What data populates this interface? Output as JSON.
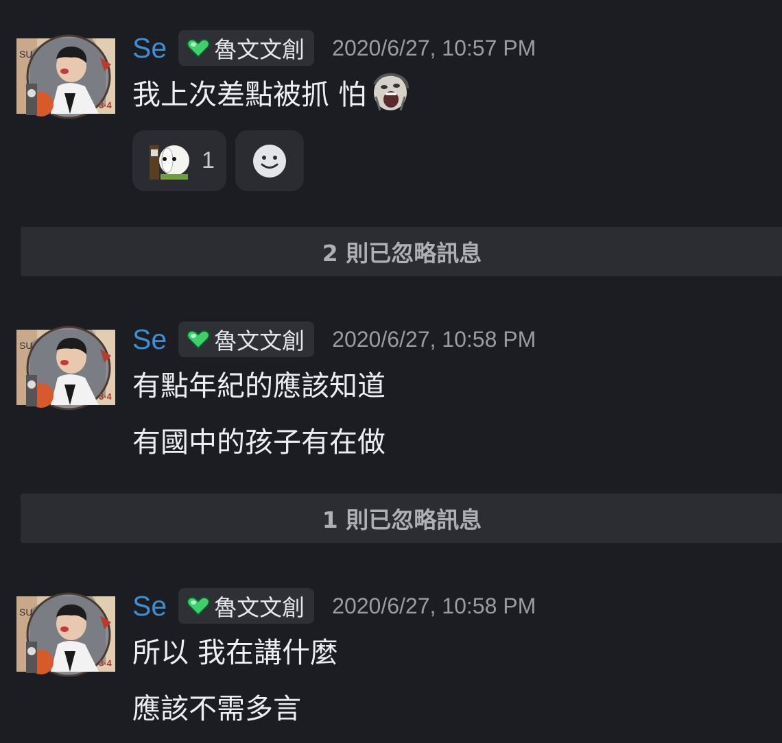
{
  "messages": [
    {
      "username": "Se",
      "role": "魯文文創",
      "timestamp": "2020/6/27, 10:57 PM",
      "lines": [
        "我上次差點被抓 怕"
      ],
      "reactions": [
        {
          "emoji": "panda-face-emoji",
          "count": "1"
        }
      ],
      "add_reaction_icon": "smiley-add-reaction-icon"
    },
    {
      "username": "Se",
      "role": "魯文文創",
      "timestamp": "2020/6/27, 10:58 PM",
      "lines": [
        "有點年紀的應該知道",
        "有國中的孩子有在做"
      ]
    },
    {
      "username": "Se",
      "role": "魯文文創",
      "timestamp": "2020/6/27, 10:58 PM",
      "lines": [
        "所以 我在講什麼",
        "應該不需多言"
      ]
    }
  ],
  "ignored": [
    {
      "label": "2 則已忽略訊息"
    },
    {
      "label": "1 則已忽略訊息"
    }
  ],
  "colors": {
    "background": "#1c1d22",
    "username": "#3c8fd3",
    "role_heart": "#3ad36a",
    "timestamp": "#9a9ca3",
    "ignored_bar": "#2b2d32"
  }
}
